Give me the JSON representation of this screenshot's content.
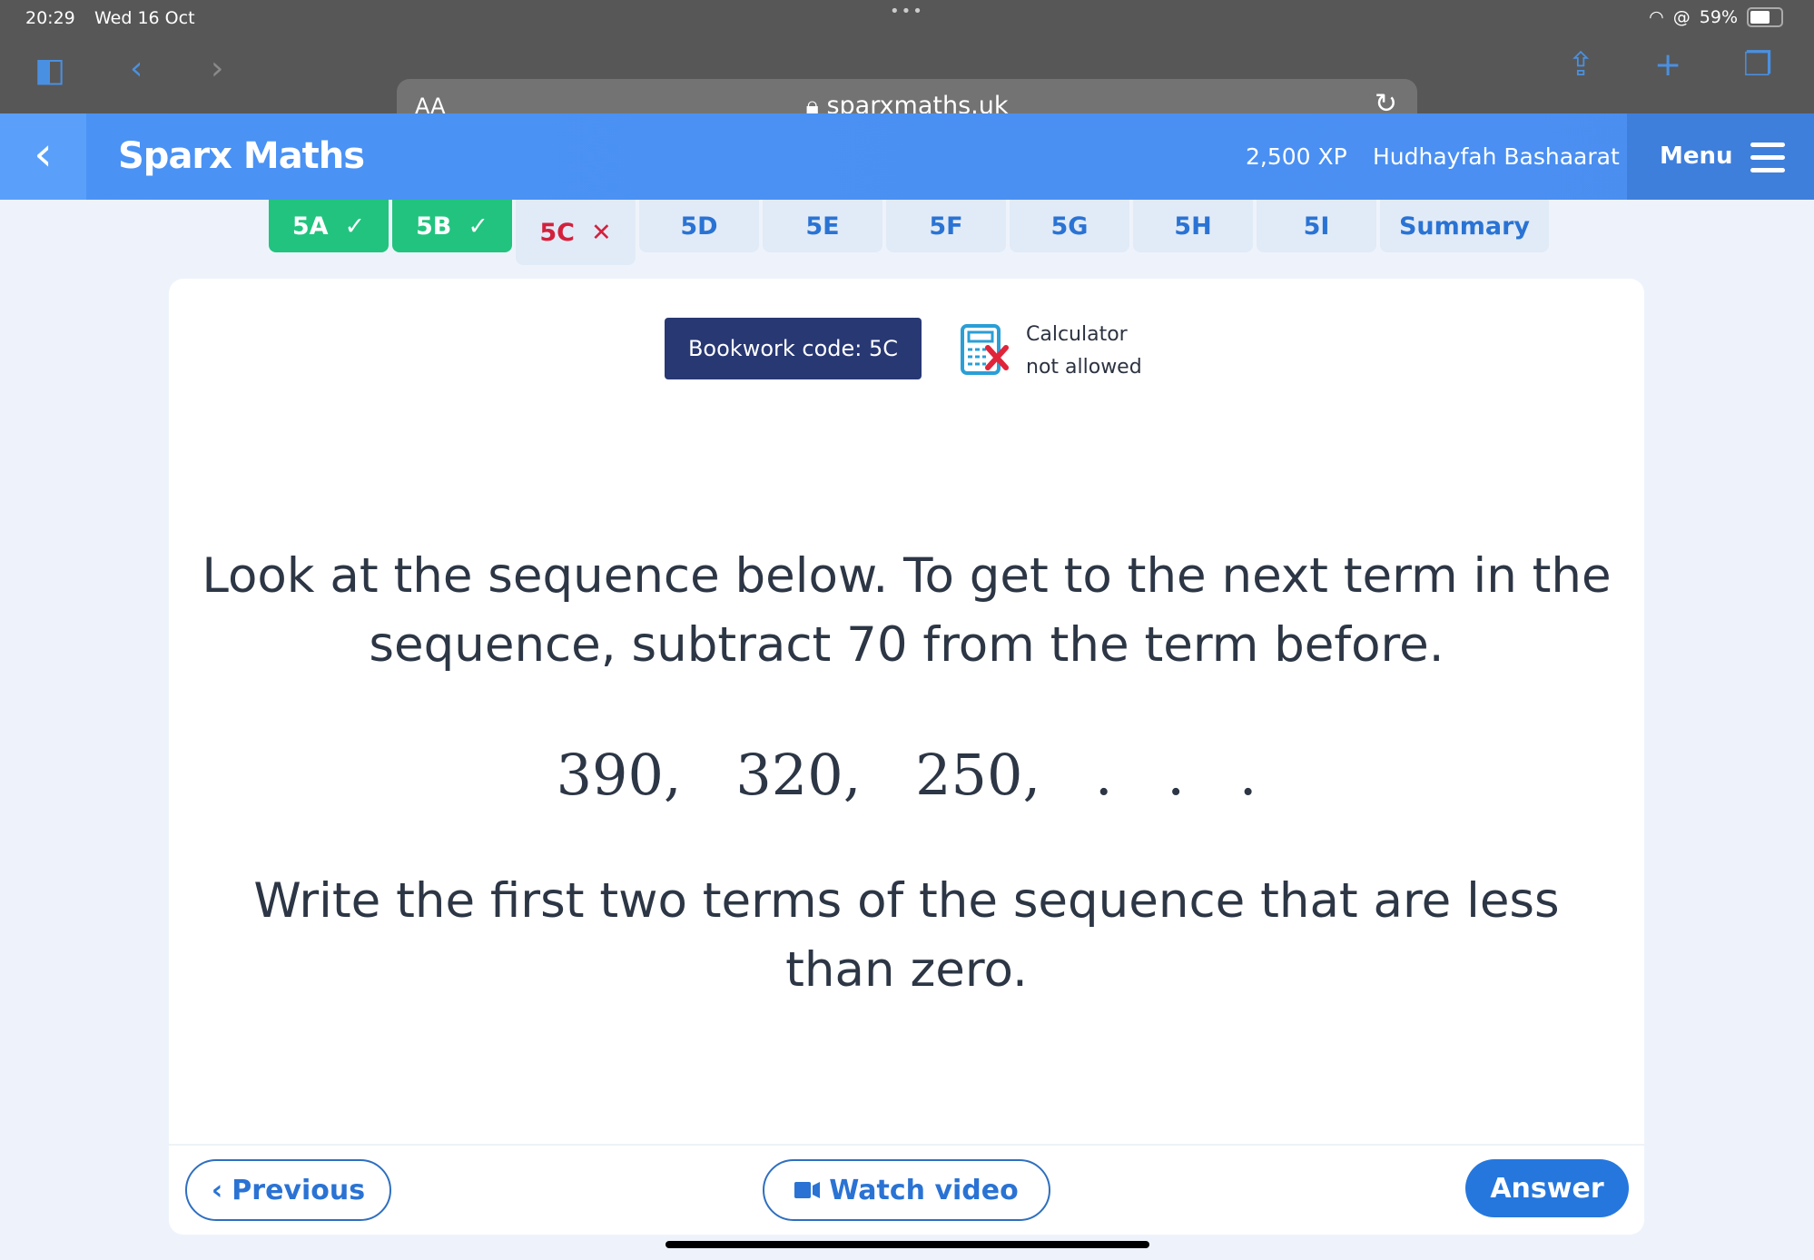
{
  "status_bar": {
    "time": "20:29",
    "date": "Wed 16 Oct",
    "battery": "59%"
  },
  "browser": {
    "text_size_label": "AA",
    "url": "sparxmaths.uk"
  },
  "header": {
    "brand": "Sparx Maths",
    "xp": "2,500 XP",
    "user": "Hudhayfah Bashaarat",
    "menu_label": "Menu"
  },
  "tabs": [
    {
      "label": "5A",
      "status": "✓"
    },
    {
      "label": "5B",
      "status": "✓"
    },
    {
      "label": "5C",
      "status": "✕"
    },
    {
      "label": "5D"
    },
    {
      "label": "5E"
    },
    {
      "label": "5F"
    },
    {
      "label": "5G"
    },
    {
      "label": "5H"
    },
    {
      "label": "5I"
    },
    {
      "label": "Summary"
    }
  ],
  "question": {
    "bookwork": "Bookwork code: 5C",
    "calc_line1": "Calculator",
    "calc_line2": "not allowed",
    "line1a": "Look at the sequence below. To get to the next term in the",
    "line1b": "sequence, subtract 70 from the term before.",
    "sequence": "390,  320,  250,  . . .",
    "line2a": "Write the first two terms of the sequence that are less",
    "line2b": "than zero."
  },
  "buttons": {
    "previous": "Previous",
    "watch_video": "Watch video",
    "answer": "Answer"
  },
  "colors": {
    "header": "#4a93f5",
    "done": "#22c37e",
    "wrong": "#d3213c",
    "bookwork": "#273873",
    "answer": "#2577dd"
  }
}
